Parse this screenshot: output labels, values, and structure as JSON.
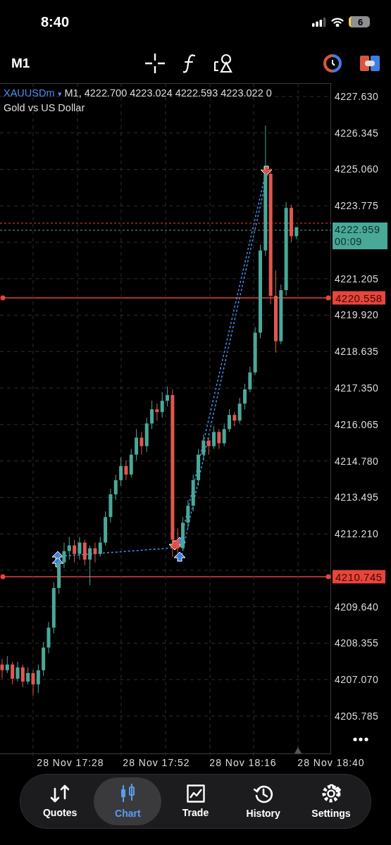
{
  "status_bar": {
    "time": "8:40",
    "battery": "6"
  },
  "toolbar": {
    "timeframe": "M1"
  },
  "chart": {
    "symbol": "XAUUSDm",
    "symbol_menu": "▾",
    "ohlc": "M1, 4222.700 4223.024 4222.593 4223.022 0",
    "description": "Gold vs US Dollar",
    "current_price": {
      "price": "4222.959",
      "countdown": "00:09"
    },
    "time_axis": [
      "28 Nov 17:28",
      "28 Nov 17:52",
      "28 Nov 18:16",
      "28 Nov 18:40"
    ],
    "price_lines": [
      {
        "label": "4220.558"
      },
      {
        "label": "4210.745"
      }
    ],
    "chart_data": {
      "type": "candlestick",
      "ylim": [
        4204.44,
        4228.1
      ],
      "grid": true,
      "yticks": [
        {
          "value": 4227.63,
          "label": "4227.630"
        },
        {
          "value": 4226.345,
          "label": "4226.345"
        },
        {
          "value": 4225.06,
          "label": "4225.060"
        },
        {
          "value": 4223.775,
          "label": "4223.775"
        },
        {
          "value": 4221.205,
          "label": "4221.205"
        },
        {
          "value": 4219.92,
          "label": "4219.920"
        },
        {
          "value": 4218.635,
          "label": "4218.635"
        },
        {
          "value": 4217.35,
          "label": "4217.350"
        },
        {
          "value": 4216.065,
          "label": "4216.065"
        },
        {
          "value": 4214.78,
          "label": "4214.780"
        },
        {
          "value": 4213.495,
          "label": "4213.495"
        },
        {
          "value": 4212.21,
          "label": "4212.210"
        },
        {
          "value": 4209.64,
          "label": "4209.640"
        },
        {
          "value": 4208.355,
          "label": "4208.355"
        },
        {
          "value": 4207.07,
          "label": "4207.070"
        },
        {
          "value": 4205.785,
          "label": "4205.785"
        }
      ],
      "categories": [
        null,
        null,
        null,
        null,
        null,
        null,
        null,
        null,
        null,
        null,
        null,
        null,
        null,
        null,
        null,
        null,
        null,
        null,
        null,
        null,
        null,
        null,
        null,
        null,
        null,
        null,
        null,
        null,
        null,
        null,
        null,
        null,
        null,
        null,
        null,
        null,
        null,
        null,
        null,
        null,
        null,
        null,
        null,
        null,
        null,
        null,
        null,
        null,
        null,
        null,
        null,
        null,
        null,
        null,
        null,
        null,
        null,
        null
      ],
      "ohlc": [
        [
          4207.6,
          4207.8,
          4207.1,
          4207.4
        ],
        [
          4207.4,
          4207.9,
          4207.3,
          4207.6
        ],
        [
          4207.6,
          4207.7,
          4206.9,
          4207.1
        ],
        [
          4207.1,
          4207.7,
          4207.0,
          4207.5
        ],
        [
          4207.5,
          4207.6,
          4206.8,
          4207.0
        ],
        [
          4207.0,
          4207.5,
          4206.9,
          4207.3
        ],
        [
          4207.3,
          4207.4,
          4206.5,
          4206.9
        ],
        [
          4206.9,
          4207.6,
          4206.6,
          4207.4
        ],
        [
          4207.4,
          4208.4,
          4207.2,
          4208.2
        ],
        [
          4208.2,
          4209.1,
          4208.0,
          4208.9
        ],
        [
          4208.9,
          4210.5,
          4208.7,
          4210.3
        ],
        [
          4210.3,
          4211.5,
          4210.1,
          4211.2
        ],
        [
          4211.2,
          4211.9,
          4211.0,
          4211.6
        ],
        [
          4211.6,
          4212.1,
          4211.3,
          4211.8
        ],
        [
          4211.8,
          4212.0,
          4211.2,
          4211.5
        ],
        [
          4211.5,
          4212.1,
          4211.3,
          4211.9
        ],
        [
          4211.9,
          4212.0,
          4211.1,
          4211.3
        ],
        [
          4211.3,
          4211.8,
          4210.4,
          4211.7
        ],
        [
          4211.7,
          4211.9,
          4211.2,
          4211.5
        ],
        [
          4211.5,
          4212.1,
          4211.4,
          4211.9
        ],
        [
          4211.9,
          4213.0,
          4211.8,
          4212.8
        ],
        [
          4212.8,
          4213.8,
          4212.6,
          4213.6
        ],
        [
          4213.6,
          4214.3,
          4213.4,
          4214.1
        ],
        [
          4214.1,
          4214.9,
          4213.9,
          4214.6
        ],
        [
          4214.6,
          4214.8,
          4214.1,
          4214.3
        ],
        [
          4214.3,
          4215.2,
          4214.2,
          4215.0
        ],
        [
          4215.0,
          4215.9,
          4214.8,
          4215.6
        ],
        [
          4215.6,
          4215.8,
          4215.0,
          4215.3
        ],
        [
          4215.3,
          4216.3,
          4215.1,
          4216.1
        ],
        [
          4216.1,
          4216.9,
          4215.9,
          4216.6
        ],
        [
          4216.6,
          4216.8,
          4216.2,
          4216.5
        ],
        [
          4216.5,
          4217.2,
          4216.3,
          4216.9
        ],
        [
          4216.9,
          4217.4,
          4216.7,
          4217.1
        ],
        [
          4217.1,
          4217.3,
          4211.4,
          4212.0
        ],
        [
          4212.0,
          4212.4,
          4211.5,
          4211.7
        ],
        [
          4211.7,
          4212.8,
          4211.6,
          4212.6
        ],
        [
          4212.6,
          4213.4,
          4212.4,
          4213.2
        ],
        [
          4213.2,
          4214.3,
          4213.0,
          4214.1
        ],
        [
          4214.1,
          4215.2,
          4213.9,
          4215.0
        ],
        [
          4215.0,
          4215.7,
          4214.8,
          4215.5
        ],
        [
          4215.5,
          4215.6,
          4215.0,
          4215.3
        ],
        [
          4215.3,
          4216.0,
          4215.2,
          4215.8
        ],
        [
          4215.8,
          4215.9,
          4215.2,
          4215.4
        ],
        [
          4215.4,
          4216.1,
          4215.3,
          4215.9
        ],
        [
          4215.9,
          4216.6,
          4215.8,
          4216.4
        ],
        [
          4216.4,
          4216.5,
          4216.0,
          4216.2
        ],
        [
          4216.2,
          4217.0,
          4216.1,
          4216.8
        ],
        [
          4216.8,
          4217.5,
          4216.6,
          4217.3
        ],
        [
          4217.3,
          4218.1,
          4217.2,
          4217.9
        ],
        [
          4217.9,
          4219.5,
          4217.8,
          4219.3
        ],
        [
          4219.3,
          4222.4,
          4219.1,
          4222.2
        ],
        [
          4222.2,
          4226.6,
          4222.0,
          4224.9
        ],
        [
          4224.9,
          4225.1,
          4220.3,
          4220.6
        ],
        [
          4220.6,
          4221.5,
          4218.6,
          4219.0
        ],
        [
          4219.0,
          4221.0,
          4218.9,
          4220.8
        ],
        [
          4220.8,
          4223.9,
          4220.6,
          4223.7
        ],
        [
          4223.7,
          4223.8,
          4222.5,
          4222.7
        ],
        [
          4222.7,
          4223.02,
          4222.59,
          4223.02
        ]
      ]
    }
  },
  "nav": [
    {
      "label": "Quotes",
      "selected": false
    },
    {
      "label": "Chart",
      "selected": true
    },
    {
      "label": "Trade",
      "selected": false
    },
    {
      "label": "History",
      "selected": false
    },
    {
      "label": "Settings",
      "selected": false
    }
  ]
}
